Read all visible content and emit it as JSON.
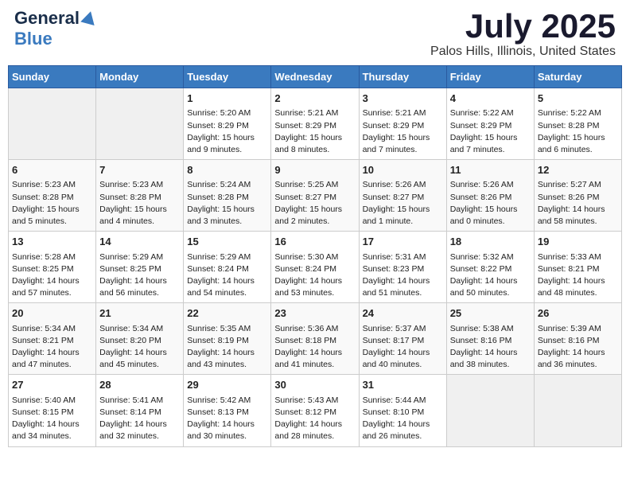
{
  "header": {
    "logo_general": "General",
    "logo_blue": "Blue",
    "month_title": "July 2025",
    "location": "Palos Hills, Illinois, United States"
  },
  "weekdays": [
    "Sunday",
    "Monday",
    "Tuesday",
    "Wednesday",
    "Thursday",
    "Friday",
    "Saturday"
  ],
  "weeks": [
    [
      {
        "day": "",
        "empty": true
      },
      {
        "day": "",
        "empty": true
      },
      {
        "day": "1",
        "sunrise": "Sunrise: 5:20 AM",
        "sunset": "Sunset: 8:29 PM",
        "daylight": "Daylight: 15 hours and 9 minutes."
      },
      {
        "day": "2",
        "sunrise": "Sunrise: 5:21 AM",
        "sunset": "Sunset: 8:29 PM",
        "daylight": "Daylight: 15 hours and 8 minutes."
      },
      {
        "day": "3",
        "sunrise": "Sunrise: 5:21 AM",
        "sunset": "Sunset: 8:29 PM",
        "daylight": "Daylight: 15 hours and 7 minutes."
      },
      {
        "day": "4",
        "sunrise": "Sunrise: 5:22 AM",
        "sunset": "Sunset: 8:29 PM",
        "daylight": "Daylight: 15 hours and 7 minutes."
      },
      {
        "day": "5",
        "sunrise": "Sunrise: 5:22 AM",
        "sunset": "Sunset: 8:28 PM",
        "daylight": "Daylight: 15 hours and 6 minutes."
      }
    ],
    [
      {
        "day": "6",
        "sunrise": "Sunrise: 5:23 AM",
        "sunset": "Sunset: 8:28 PM",
        "daylight": "Daylight: 15 hours and 5 minutes."
      },
      {
        "day": "7",
        "sunrise": "Sunrise: 5:23 AM",
        "sunset": "Sunset: 8:28 PM",
        "daylight": "Daylight: 15 hours and 4 minutes."
      },
      {
        "day": "8",
        "sunrise": "Sunrise: 5:24 AM",
        "sunset": "Sunset: 8:28 PM",
        "daylight": "Daylight: 15 hours and 3 minutes."
      },
      {
        "day": "9",
        "sunrise": "Sunrise: 5:25 AM",
        "sunset": "Sunset: 8:27 PM",
        "daylight": "Daylight: 15 hours and 2 minutes."
      },
      {
        "day": "10",
        "sunrise": "Sunrise: 5:26 AM",
        "sunset": "Sunset: 8:27 PM",
        "daylight": "Daylight: 15 hours and 1 minute."
      },
      {
        "day": "11",
        "sunrise": "Sunrise: 5:26 AM",
        "sunset": "Sunset: 8:26 PM",
        "daylight": "Daylight: 15 hours and 0 minutes."
      },
      {
        "day": "12",
        "sunrise": "Sunrise: 5:27 AM",
        "sunset": "Sunset: 8:26 PM",
        "daylight": "Daylight: 14 hours and 58 minutes."
      }
    ],
    [
      {
        "day": "13",
        "sunrise": "Sunrise: 5:28 AM",
        "sunset": "Sunset: 8:25 PM",
        "daylight": "Daylight: 14 hours and 57 minutes."
      },
      {
        "day": "14",
        "sunrise": "Sunrise: 5:29 AM",
        "sunset": "Sunset: 8:25 PM",
        "daylight": "Daylight: 14 hours and 56 minutes."
      },
      {
        "day": "15",
        "sunrise": "Sunrise: 5:29 AM",
        "sunset": "Sunset: 8:24 PM",
        "daylight": "Daylight: 14 hours and 54 minutes."
      },
      {
        "day": "16",
        "sunrise": "Sunrise: 5:30 AM",
        "sunset": "Sunset: 8:24 PM",
        "daylight": "Daylight: 14 hours and 53 minutes."
      },
      {
        "day": "17",
        "sunrise": "Sunrise: 5:31 AM",
        "sunset": "Sunset: 8:23 PM",
        "daylight": "Daylight: 14 hours and 51 minutes."
      },
      {
        "day": "18",
        "sunrise": "Sunrise: 5:32 AM",
        "sunset": "Sunset: 8:22 PM",
        "daylight": "Daylight: 14 hours and 50 minutes."
      },
      {
        "day": "19",
        "sunrise": "Sunrise: 5:33 AM",
        "sunset": "Sunset: 8:21 PM",
        "daylight": "Daylight: 14 hours and 48 minutes."
      }
    ],
    [
      {
        "day": "20",
        "sunrise": "Sunrise: 5:34 AM",
        "sunset": "Sunset: 8:21 PM",
        "daylight": "Daylight: 14 hours and 47 minutes."
      },
      {
        "day": "21",
        "sunrise": "Sunrise: 5:34 AM",
        "sunset": "Sunset: 8:20 PM",
        "daylight": "Daylight: 14 hours and 45 minutes."
      },
      {
        "day": "22",
        "sunrise": "Sunrise: 5:35 AM",
        "sunset": "Sunset: 8:19 PM",
        "daylight": "Daylight: 14 hours and 43 minutes."
      },
      {
        "day": "23",
        "sunrise": "Sunrise: 5:36 AM",
        "sunset": "Sunset: 8:18 PM",
        "daylight": "Daylight: 14 hours and 41 minutes."
      },
      {
        "day": "24",
        "sunrise": "Sunrise: 5:37 AM",
        "sunset": "Sunset: 8:17 PM",
        "daylight": "Daylight: 14 hours and 40 minutes."
      },
      {
        "day": "25",
        "sunrise": "Sunrise: 5:38 AM",
        "sunset": "Sunset: 8:16 PM",
        "daylight": "Daylight: 14 hours and 38 minutes."
      },
      {
        "day": "26",
        "sunrise": "Sunrise: 5:39 AM",
        "sunset": "Sunset: 8:16 PM",
        "daylight": "Daylight: 14 hours and 36 minutes."
      }
    ],
    [
      {
        "day": "27",
        "sunrise": "Sunrise: 5:40 AM",
        "sunset": "Sunset: 8:15 PM",
        "daylight": "Daylight: 14 hours and 34 minutes."
      },
      {
        "day": "28",
        "sunrise": "Sunrise: 5:41 AM",
        "sunset": "Sunset: 8:14 PM",
        "daylight": "Daylight: 14 hours and 32 minutes."
      },
      {
        "day": "29",
        "sunrise": "Sunrise: 5:42 AM",
        "sunset": "Sunset: 8:13 PM",
        "daylight": "Daylight: 14 hours and 30 minutes."
      },
      {
        "day": "30",
        "sunrise": "Sunrise: 5:43 AM",
        "sunset": "Sunset: 8:12 PM",
        "daylight": "Daylight: 14 hours and 28 minutes."
      },
      {
        "day": "31",
        "sunrise": "Sunrise: 5:44 AM",
        "sunset": "Sunset: 8:10 PM",
        "daylight": "Daylight: 14 hours and 26 minutes."
      },
      {
        "day": "",
        "empty": true
      },
      {
        "day": "",
        "empty": true
      }
    ]
  ]
}
